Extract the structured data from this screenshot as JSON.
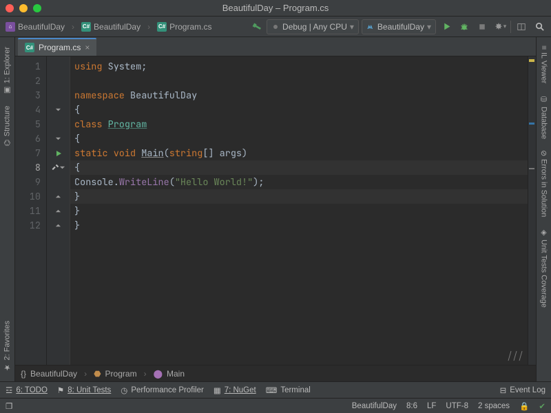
{
  "window": {
    "title": "BeautifulDay – Program.cs"
  },
  "breadcrumb": {
    "root": "BeautifulDay",
    "project": "BeautifulDay",
    "file": "Program.cs"
  },
  "toolbar": {
    "config": "Debug | Any CPU",
    "run_target": "BeautifulDay"
  },
  "left_rail": {
    "explorer": "1: Explorer",
    "structure": "Structure",
    "favorites": "2: Favorites"
  },
  "right_rail": {
    "il_viewer": "IL Viewer",
    "database": "Database",
    "errors": "Errors in Solution",
    "coverage": "Unit Tests Coverage"
  },
  "tab": {
    "label": "Program.cs"
  },
  "code": {
    "lines": [
      {
        "n": 1,
        "ind": 0,
        "tokens": [
          [
            "kw",
            "using "
          ],
          [
            "pun",
            "System;"
          ]
        ]
      },
      {
        "n": 2,
        "ind": 0,
        "tokens": []
      },
      {
        "n": 3,
        "ind": 0,
        "tokens": [
          [
            "kw",
            "namespace "
          ],
          [
            "pun",
            "BeautifulDay"
          ]
        ]
      },
      {
        "n": 4,
        "ind": 0,
        "tokens": [
          [
            "pun",
            "{"
          ]
        ]
      },
      {
        "n": 5,
        "ind": 1,
        "tokens": [
          [
            "kw",
            "class "
          ],
          [
            "type ulink",
            "Program"
          ]
        ]
      },
      {
        "n": 6,
        "ind": 1,
        "tokens": [
          [
            "pun",
            "{"
          ]
        ]
      },
      {
        "n": 7,
        "ind": 2,
        "tokens": [
          [
            "kw",
            "static "
          ],
          [
            "kw",
            "void "
          ],
          [
            "fn",
            "Main"
          ],
          [
            "pun",
            "("
          ],
          [
            "kw",
            "string"
          ],
          [
            "pun",
            "[] args)"
          ]
        ],
        "run": true
      },
      {
        "n": 8,
        "ind": 2,
        "tokens": [
          [
            "pun",
            "{"
          ]
        ],
        "cur": true
      },
      {
        "n": 9,
        "ind": 3,
        "tokens": [
          [
            "pun",
            "Console."
          ],
          [
            "id",
            "WriteLine"
          ],
          [
            "pun",
            "("
          ],
          [
            "str",
            "\"Hello World!\""
          ],
          [
            "pun",
            ");"
          ]
        ]
      },
      {
        "n": 10,
        "ind": 2,
        "tokens": [
          [
            "pun",
            "}"
          ]
        ],
        "hl": true
      },
      {
        "n": 11,
        "ind": 1,
        "tokens": [
          [
            "pun",
            "}"
          ]
        ]
      },
      {
        "n": 12,
        "ind": 0,
        "tokens": [
          [
            "pun",
            "}"
          ]
        ]
      }
    ]
  },
  "code_crumbs": {
    "ns": "BeautifulDay",
    "cls": "Program",
    "fn": "Main"
  },
  "bottom_tools": {
    "todo": "6: TODO",
    "unit": "8: Unit Tests",
    "profiler": "Performance Profiler",
    "nuget": "7: NuGet",
    "terminal": "Terminal",
    "eventlog": "Event Log"
  },
  "status": {
    "project": "BeautifulDay",
    "pos": "8:6",
    "le": "LF",
    "enc": "UTF-8",
    "indent": "2 spaces"
  }
}
